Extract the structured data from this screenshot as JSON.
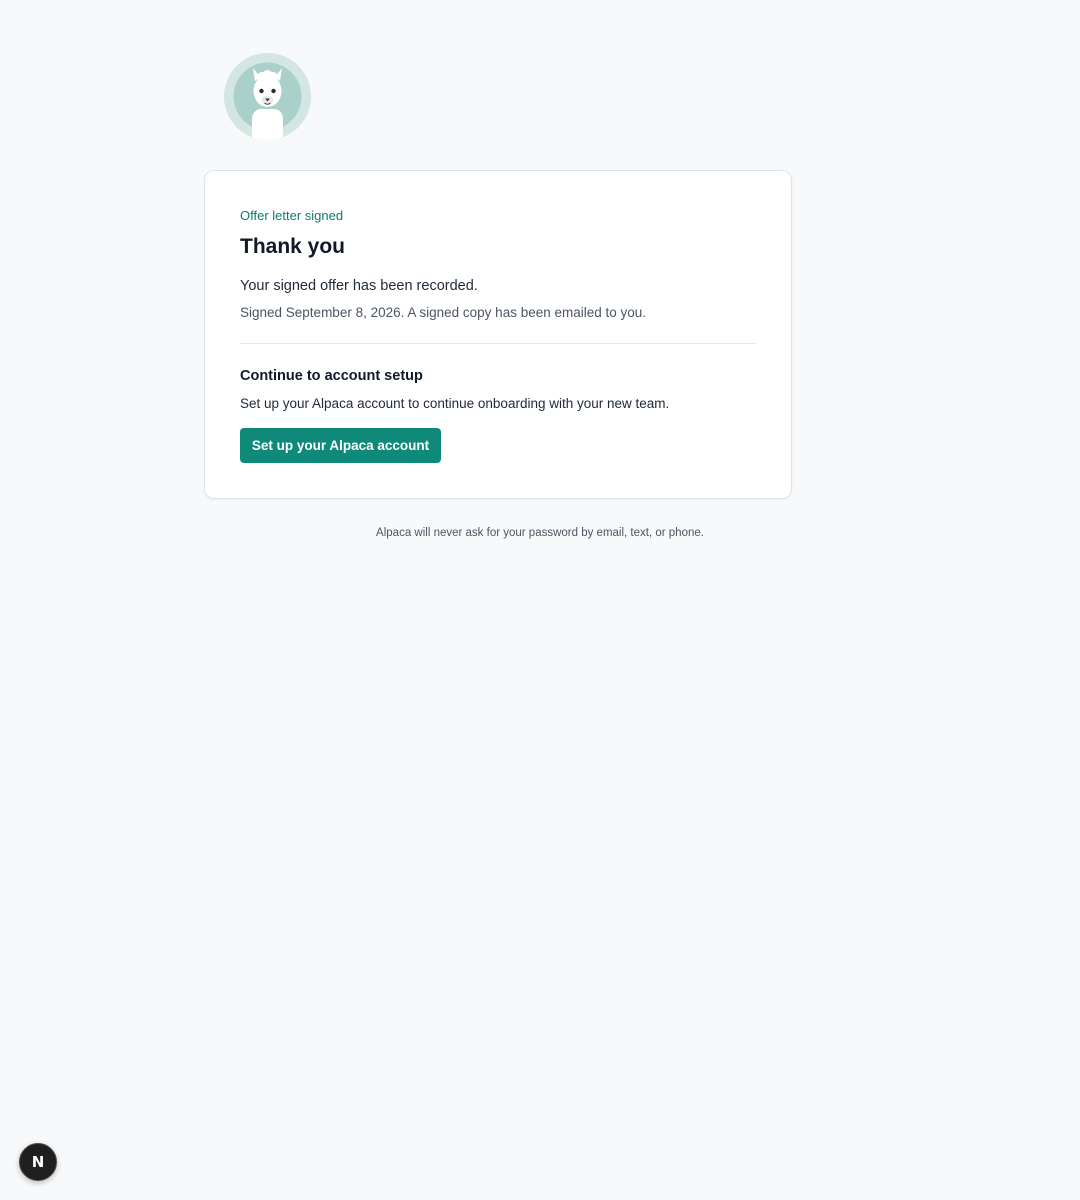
{
  "brand": {
    "logo_icon": "alpaca-logo-icon"
  },
  "card": {
    "eyebrow": "Offer letter signed",
    "title": "Thank you",
    "lead": "Your signed offer has been recorded.",
    "meta": "Signed September 8, 2026. A signed copy has been emailed to you.",
    "next_title": "Continue to account setup",
    "next_desc": "Set up your Alpaca account to continue onboarding with your new team.",
    "cta_label": "Set up your Alpaca account"
  },
  "footer": {
    "note": "Alpaca will never ask for your password by email, text, or phone."
  },
  "dev_badge": {
    "label": "N"
  },
  "colors": {
    "accent": "#0f8a7a",
    "eyebrow": "#0d7d6c",
    "background": "#f8f9fb"
  }
}
